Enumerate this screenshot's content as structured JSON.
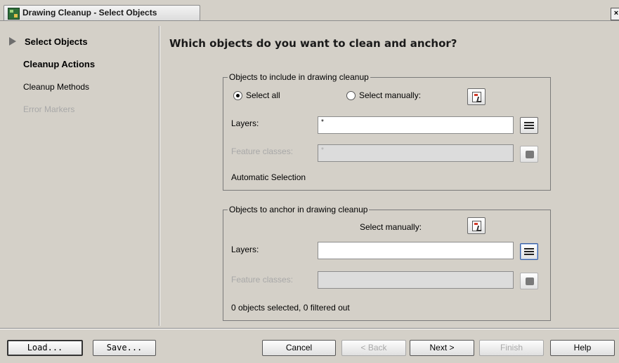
{
  "window": {
    "title": "Drawing Cleanup - Select Objects",
    "close_glyph": "×",
    "icon": "drawing-cleanup-app-icon"
  },
  "nav": {
    "items": [
      {
        "label": "Select Objects",
        "state": "current"
      },
      {
        "label": "Cleanup Actions",
        "state": "enabled-bold"
      },
      {
        "label": "Cleanup Methods",
        "state": "enabled"
      },
      {
        "label": "Error Markers",
        "state": "disabled"
      }
    ]
  },
  "main": {
    "heading": "Which objects do you want to clean and anchor?",
    "include_group": {
      "title": "Objects to include in drawing cleanup",
      "radio_select_all": "Select all",
      "radio_select_manually": "Select manually:",
      "selected_option": "Select all",
      "layers_label": "Layers:",
      "layers_value": "*",
      "feature_classes_label": "Feature classes:",
      "feature_classes_value": "*",
      "status": "Automatic Selection"
    },
    "anchor_group": {
      "title": "Objects to anchor in drawing cleanup",
      "select_manually_label": "Select manually:",
      "layers_label": "Layers:",
      "layers_value": "",
      "feature_classes_label": "Feature classes:",
      "feature_classes_value": "",
      "status": "0 objects selected, 0 filtered out"
    }
  },
  "footer": {
    "load": "Load...",
    "save": "Save...",
    "cancel": "Cancel",
    "back": "< Back",
    "next": "Next >",
    "finish": "Finish",
    "help": "Help"
  },
  "colors": {
    "background": "#d4d0c8",
    "disabled_text": "#a8a8a8",
    "nav_arrow": "#6e6e6e"
  }
}
